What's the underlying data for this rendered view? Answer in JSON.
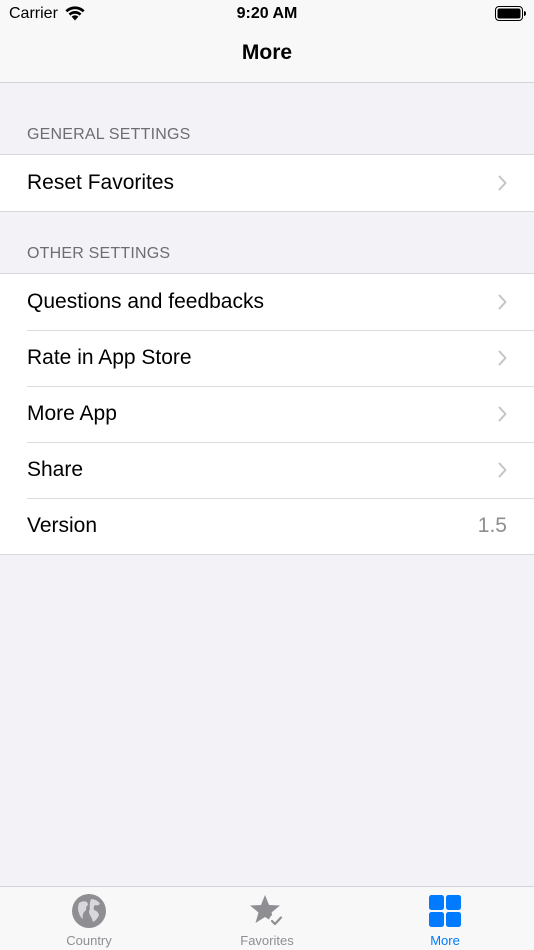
{
  "status_bar": {
    "carrier": "Carrier",
    "time": "9:20 AM"
  },
  "nav": {
    "title": "More"
  },
  "sections": [
    {
      "header": "GENERAL SETTINGS",
      "rows": [
        {
          "label": "Reset Favorites"
        }
      ]
    },
    {
      "header": "OTHER SETTINGS",
      "rows": [
        {
          "label": "Questions and feedbacks"
        },
        {
          "label": "Rate in App Store"
        },
        {
          "label": "More App"
        },
        {
          "label": "Share"
        },
        {
          "label": "Version",
          "value": "1.5"
        }
      ]
    }
  ],
  "tabbar": {
    "tabs": [
      {
        "label": "Country",
        "icon": "globe-icon",
        "active": false
      },
      {
        "label": "Favorites",
        "icon": "star-check-icon",
        "active": false
      },
      {
        "label": "More",
        "icon": "grid-icon",
        "active": true
      }
    ]
  },
  "colors": {
    "accent": "#007aff",
    "inactive": "#8e8e93",
    "background": "#f2f2f7"
  }
}
